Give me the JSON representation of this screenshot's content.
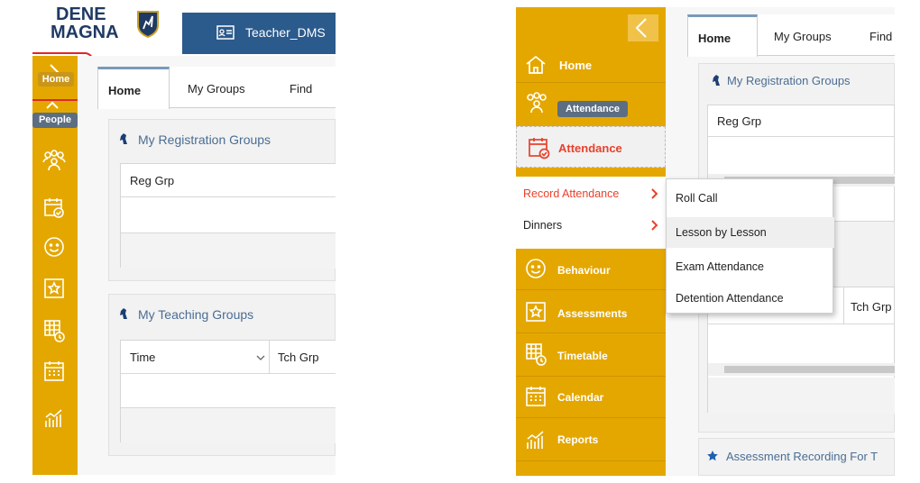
{
  "left": {
    "logo": {
      "line1": "DENE",
      "line2": "MAGNA"
    },
    "user": "Teacher_DMS",
    "sidebar_tooltips": {
      "home": "Home",
      "people": "People"
    },
    "tabs": [
      {
        "label": "Home"
      },
      {
        "label": "My Groups"
      },
      {
        "label": "Find"
      }
    ],
    "reg_groups": {
      "title": "My Registration Groups",
      "column": "Reg Grp"
    },
    "teaching_groups": {
      "title": "My Teaching Groups",
      "col_time": "Time",
      "col_tch": "Tch Grp"
    }
  },
  "right": {
    "nav": [
      {
        "label": "Home",
        "icon": "home-icon"
      },
      {
        "label": "Attendance",
        "icon": "calendar-check-icon"
      },
      {
        "label": "Behaviour",
        "icon": "smiley-icon"
      },
      {
        "label": "Assessments",
        "icon": "star-box-icon"
      },
      {
        "label": "Timetable",
        "icon": "timetable-icon"
      },
      {
        "label": "Calendar",
        "icon": "calendar-icon"
      },
      {
        "label": "Reports",
        "icon": "chart-icon"
      }
    ],
    "tooltip": "Attendance",
    "submenu": [
      {
        "label": "Record Attendance"
      },
      {
        "label": "Dinners"
      }
    ],
    "flyout": [
      {
        "label": "Roll Call"
      },
      {
        "label": "Lesson by Lesson"
      },
      {
        "label": "Exam Attendance"
      },
      {
        "label": "Detention Attendance"
      }
    ],
    "tabs": [
      {
        "label": "Home"
      },
      {
        "label": "My Groups"
      },
      {
        "label": "Find"
      }
    ],
    "reg_groups": {
      "title": "My Registration Groups",
      "column": "Reg Grp"
    },
    "tch_col": "Tch Grp",
    "assessment_title": "Assessment Recording For T"
  },
  "colors": {
    "sidebar": "#e4a700",
    "accent_red": "#e8412c",
    "header_blue": "#4a6d93",
    "logo_navy": "#1f3a63"
  }
}
